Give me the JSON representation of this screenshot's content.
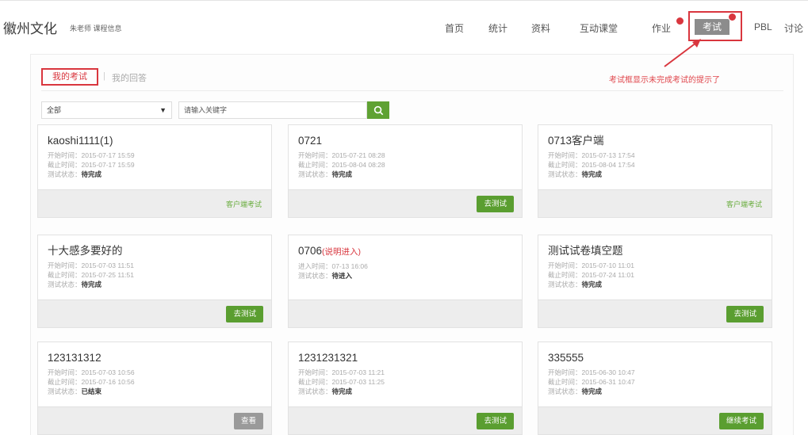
{
  "header": {
    "course_title": "徽州文化",
    "course_sub": "朱老师 课程信息",
    "nav": [
      {
        "label": "首页"
      },
      {
        "label": "统计"
      },
      {
        "label": "资料"
      },
      {
        "label": "互动课堂"
      },
      {
        "label": "作业",
        "badge": true
      },
      {
        "label": "考试",
        "active": true,
        "badge": true
      },
      {
        "label": "PBL"
      },
      {
        "label": "讨论"
      }
    ]
  },
  "tabs": {
    "mine": "我的考试",
    "separator": "|",
    "other": "我的回答"
  },
  "annotation": "考试框显示未完成考试的提示了",
  "filter": {
    "select_value": "全部",
    "search_placeholder": "请输入关键字"
  },
  "icons": {
    "dropdown": "chevron-down-icon",
    "search": "search-icon",
    "arrow": "annotation-arrow-icon"
  },
  "colors": {
    "accent": "#5fa233",
    "alert": "#d9363e",
    "active_tab": "#8c8c8c"
  },
  "exams": {
    "status_label": "测试状态：",
    "cards": [
      {
        "title": "kaoshi1111(1)",
        "title_note": "",
        "lines": [
          "开始时间：2015-07-17 15:59",
          "截止时间：2015-07-17 15:59"
        ],
        "status": "待完成",
        "action": {
          "label": "客户端考试",
          "type": "link"
        }
      },
      {
        "title": "0721",
        "title_note": "",
        "lines": [
          "开始时间：2015-07-21 08:28",
          "截止时间：2015-08-04 08:28"
        ],
        "status": "待完成",
        "action": {
          "label": "去测试",
          "type": "button"
        }
      },
      {
        "title": "0713客户端",
        "title_note": "",
        "lines": [
          "开始时间：2015-07-13 17:54",
          "截止时间：2015-08-04 17:54"
        ],
        "status": "待完成",
        "action": {
          "label": "客户端考试",
          "type": "link"
        }
      },
      {
        "title": "十大感多要好的",
        "title_note": "",
        "lines": [
          "开始时间：2015-07-03 11:51",
          "截止时间：2015-07-25 11:51"
        ],
        "status": "待完成",
        "action": {
          "label": "去测试",
          "type": "button"
        }
      },
      {
        "title": "0706",
        "title_note": "(说明进入)",
        "lines": [
          "进入时间：07-13 16:06"
        ],
        "status": "待进入",
        "action": null
      },
      {
        "title": "测试试卷填空题",
        "title_note": "",
        "lines": [
          "开始时间：2015-07-10 11:01",
          "截止时间：2015-07-24 11:01"
        ],
        "status": "待完成",
        "action": {
          "label": "去测试",
          "type": "button"
        }
      },
      {
        "title": "123131312",
        "title_note": "",
        "lines": [
          "开始时间：2015-07-03 10:56",
          "截止时间：2015-07-16 10:56"
        ],
        "status": "已结束",
        "action": {
          "label": "查看",
          "type": "button-gray"
        }
      },
      {
        "title": "1231231321",
        "title_note": "",
        "lines": [
          "开始时间：2015-07-03 11:21",
          "截止时间：2015-07-03 11:25"
        ],
        "status": "待完成",
        "action": {
          "label": "去测试",
          "type": "button"
        }
      },
      {
        "title": "335555",
        "title_note": "",
        "lines": [
          "开始时间：2015-06-30 10:47",
          "截止时间：2015-06-31 10:47"
        ],
        "status": "待完成",
        "action": {
          "label": "继续考试",
          "type": "button"
        }
      }
    ]
  }
}
